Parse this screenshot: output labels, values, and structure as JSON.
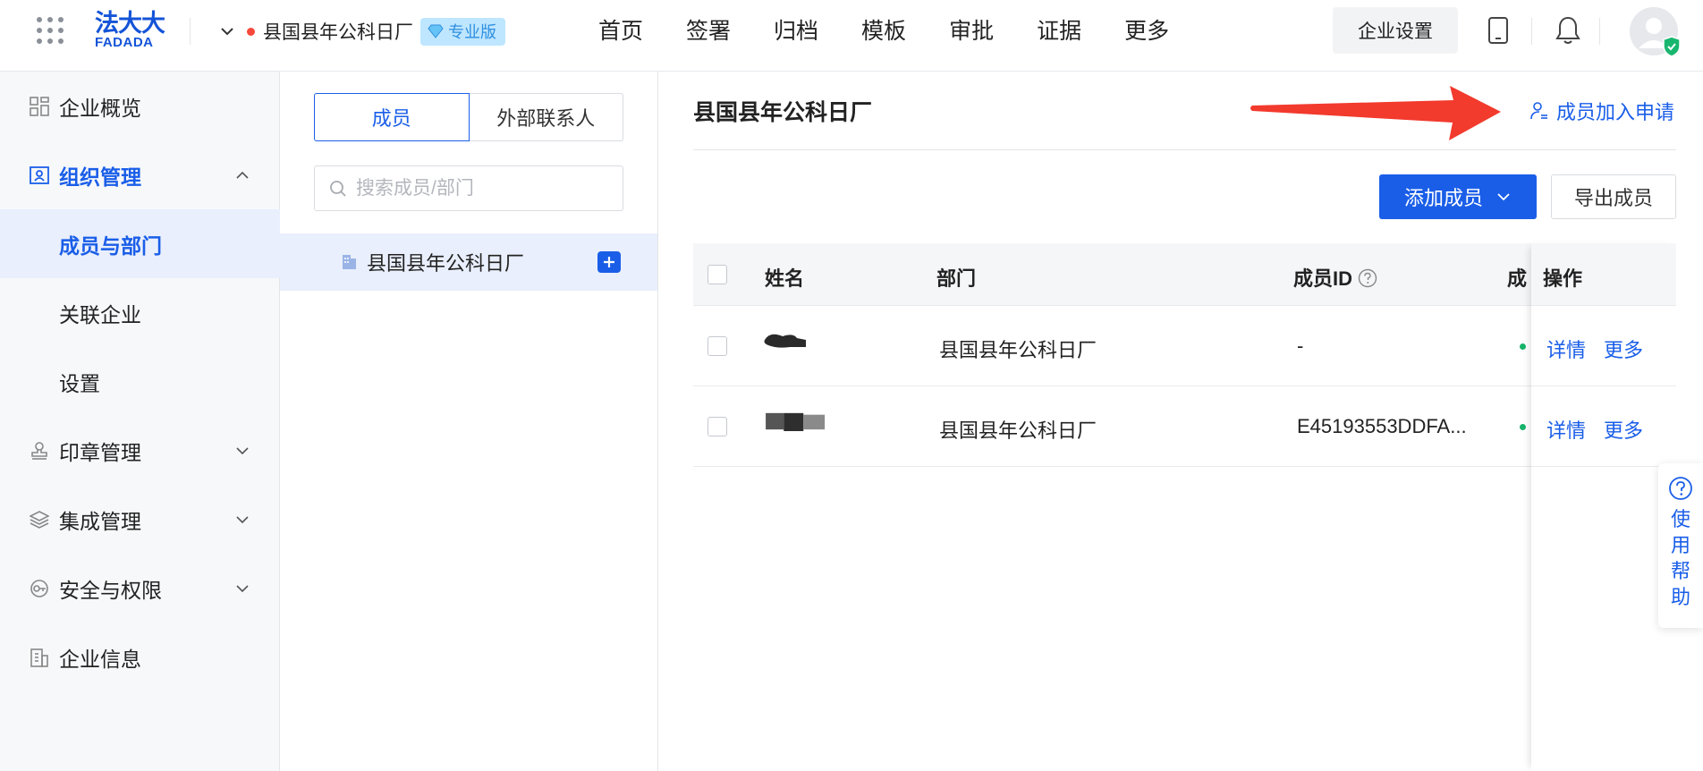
{
  "header": {
    "apps_icon": "grid-apps-icon",
    "logo": {
      "cn": "法大大",
      "en": "FADADA"
    },
    "org_name": "县国县年公科日厂",
    "badge": "专业版",
    "nav": [
      "首页",
      "签署",
      "归档",
      "模板",
      "审批",
      "证据",
      "更多"
    ],
    "enterprise_settings": "企业设置",
    "icons": [
      "mobile-icon",
      "bell-icon",
      "avatar"
    ]
  },
  "sidebar": {
    "items": [
      {
        "label": "企业概览",
        "icon": "dashboard-icon"
      },
      {
        "label": "组织管理",
        "icon": "org-icon",
        "expanded": true
      },
      {
        "label": "成员与部门",
        "selected": true
      },
      {
        "label": "关联企业"
      },
      {
        "label": "设置"
      },
      {
        "label": "印章管理",
        "icon": "seal-icon"
      },
      {
        "label": "集成管理",
        "icon": "layers-icon"
      },
      {
        "label": "安全与权限",
        "icon": "key-icon"
      },
      {
        "label": "企业信息",
        "icon": "building-icon"
      }
    ]
  },
  "panel": {
    "tabs": [
      "成员",
      "外部联系人"
    ],
    "active_tab": "成员",
    "search_placeholder": "搜索成员/部门",
    "tree_root": "县国县年公科日厂"
  },
  "main": {
    "title": "县国县年公科日厂",
    "join_request": "成员加入申请",
    "add_member": "添加成员",
    "export_member": "导出成员",
    "columns": {
      "name": "姓名",
      "dept": "部门",
      "member_id": "成员ID",
      "status": "成",
      "ops": "操作"
    },
    "rows": [
      {
        "dept": "县国县年公科日厂",
        "member_id": "-",
        "detail": "详情",
        "more": "更多"
      },
      {
        "dept": "县国县年公科日厂",
        "member_id": "E45193553DDFA...",
        "detail": "详情",
        "more": "更多"
      }
    ]
  },
  "help": {
    "label": "使用帮助"
  },
  "colors": {
    "primary": "#1a5ee8",
    "arrow": "#f23a2d",
    "status_ok": "#16b36b"
  }
}
